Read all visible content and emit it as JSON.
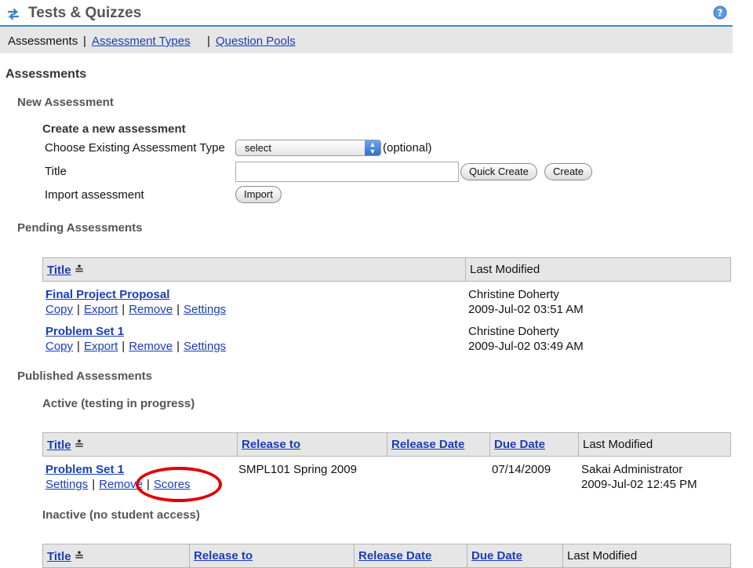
{
  "header": {
    "title": "Tests & Quizzes",
    "left_icon": "refresh-arrows-icon",
    "help_icon": "help-icon"
  },
  "nav": {
    "current": "Assessments",
    "sep": "|",
    "assessment_types": "Assessment Types",
    "question_pools": "Question Pools"
  },
  "page": {
    "heading": "Assessments",
    "new_assessment": "New Assessment",
    "create_new": "Create a new assessment",
    "choose_type_label": "Choose Existing Assessment Type",
    "type_select_value": "select",
    "optional": "(optional)",
    "title_label": "Title",
    "title_value": "",
    "quick_create": "Quick Create",
    "create": "Create",
    "import_label": "Import assessment",
    "import_button": "Import"
  },
  "pending": {
    "heading": "Pending Assessments",
    "col_title": "Title",
    "col_last_modified": "Last Modified",
    "rows": [
      {
        "title": "Final Project Proposal",
        "actions": [
          "Copy",
          "Export",
          "Remove",
          "Settings"
        ],
        "modified_by": "Christine Doherty",
        "modified_at": "2009-Jul-02 03:51 AM"
      },
      {
        "title": "Problem Set 1",
        "actions": [
          "Copy",
          "Export",
          "Remove",
          "Settings"
        ],
        "modified_by": "Christine Doherty",
        "modified_at": "2009-Jul-02 03:49 AM"
      }
    ]
  },
  "published": {
    "heading": "Published Assessments",
    "active_heading": "Active (testing in progress)",
    "inactive_heading": "Inactive (no student access)",
    "col_title": "Title",
    "col_release_to": "Release to",
    "col_release_date": "Release Date",
    "col_due_date": "Due Date",
    "col_last_modified": "Last Modified",
    "active_rows": [
      {
        "title": "Problem Set 1",
        "actions": [
          "Settings",
          "Remove",
          "Scores"
        ],
        "release_to": "SMPL101 Spring 2009",
        "release_date": "",
        "due_date": "07/14/2009",
        "modified_by": "Sakai Administrator",
        "modified_at": "2009-Jul-02 12:45 PM"
      }
    ]
  },
  "colors": {
    "link": "#1a3db8",
    "header_rule": "#2f8fc9",
    "annotation_ring": "#e00000"
  }
}
